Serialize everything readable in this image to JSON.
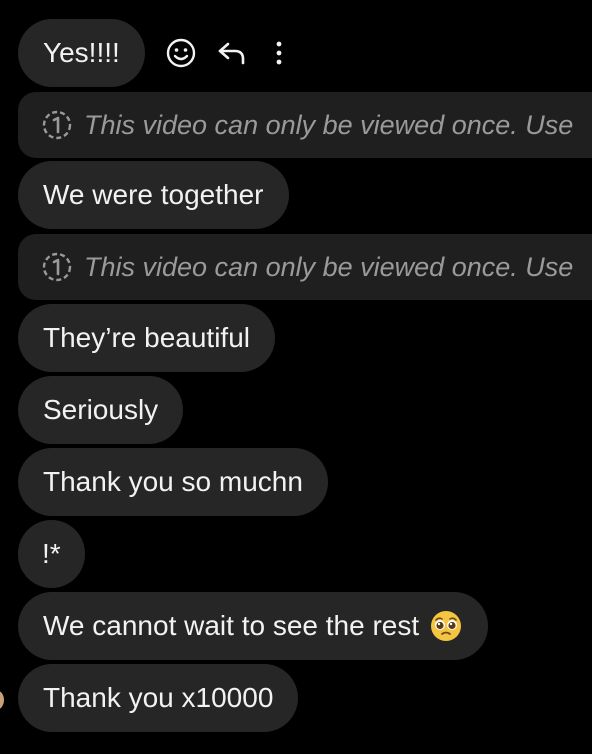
{
  "messages": [
    {
      "type": "text",
      "text": "Yes!!!!"
    },
    {
      "type": "notice",
      "text": "This video can only be viewed once. Use"
    },
    {
      "type": "text",
      "text": "We were together"
    },
    {
      "type": "notice",
      "text": "This video can only be viewed once. Use"
    },
    {
      "type": "text",
      "text": "They’re beautiful"
    },
    {
      "type": "text",
      "text": "Seriously"
    },
    {
      "type": "text",
      "text": "Thank you so muchn"
    },
    {
      "type": "text",
      "text": "!*"
    },
    {
      "type": "text",
      "text": "We cannot wait to see the rest",
      "emoji": "pleading-face-emoji"
    },
    {
      "type": "text",
      "text": "Thank you x10000"
    }
  ],
  "actions": {
    "icons": [
      "smiley-react-icon",
      "reply-arrow-icon",
      "more-vertical-icon"
    ]
  },
  "colors": {
    "background": "#000000",
    "bubble": "#262626",
    "notice": "#1f1f1f",
    "text": "#f2f2f2",
    "notice_text": "#9a9a9a"
  }
}
